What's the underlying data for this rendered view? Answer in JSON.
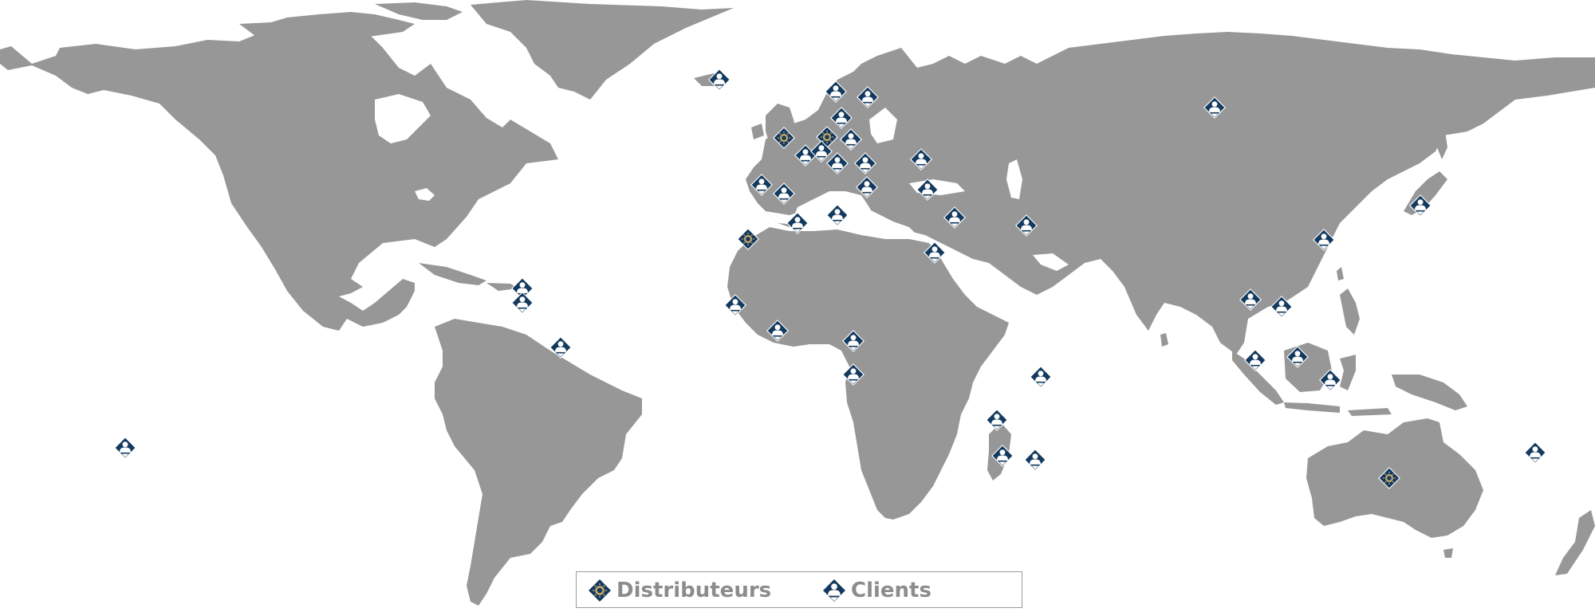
{
  "map": {
    "title": "",
    "colors": {
      "land": "#979797",
      "marker_fill": "#12395e",
      "distributor_accent": "#c0a46c",
      "legend_text": "#8c8c8c",
      "legend_border": "#9a9a9a"
    },
    "legend": {
      "items": [
        {
          "label": "Distributeurs",
          "icon": "distributor-marker-icon"
        },
        {
          "label": "Clients",
          "icon": "client-marker-icon"
        }
      ]
    },
    "markers": [
      {
        "type": "client",
        "region": "Greenland"
      },
      {
        "type": "client",
        "region": "Scandinavia"
      },
      {
        "type": "client",
        "region": "Scandinavia"
      },
      {
        "type": "distributor",
        "region": "United Kingdom"
      },
      {
        "type": "distributor",
        "region": "Western Europe"
      },
      {
        "type": "client",
        "region": "Europe"
      },
      {
        "type": "client",
        "region": "Europe"
      },
      {
        "type": "client",
        "region": "Europe"
      },
      {
        "type": "client",
        "region": "Europe"
      },
      {
        "type": "client",
        "region": "Europe"
      },
      {
        "type": "client",
        "region": "Europe"
      },
      {
        "type": "client",
        "region": "Eastern Europe"
      },
      {
        "type": "client",
        "region": "Iberia"
      },
      {
        "type": "client",
        "region": "Iberia"
      },
      {
        "type": "client",
        "region": "Balkans"
      },
      {
        "type": "client",
        "region": "Turkey"
      },
      {
        "type": "client",
        "region": "North Africa"
      },
      {
        "type": "client",
        "region": "North Africa"
      },
      {
        "type": "distributor",
        "region": "Morocco"
      },
      {
        "type": "client",
        "region": "Middle East"
      },
      {
        "type": "client",
        "region": "Gulf"
      },
      {
        "type": "client",
        "region": "Egypt"
      },
      {
        "type": "client",
        "region": "Russia"
      },
      {
        "type": "client",
        "region": "West Africa"
      },
      {
        "type": "client",
        "region": "West Africa"
      },
      {
        "type": "client",
        "region": "Central Africa"
      },
      {
        "type": "client",
        "region": "Central Africa"
      },
      {
        "type": "client",
        "region": "Indian Ocean"
      },
      {
        "type": "client",
        "region": "Madagascar"
      },
      {
        "type": "client",
        "region": "Madagascar"
      },
      {
        "type": "client",
        "region": "Mauritius"
      },
      {
        "type": "client",
        "region": "Caribbean"
      },
      {
        "type": "client",
        "region": "Caribbean"
      },
      {
        "type": "client",
        "region": "Guiana"
      },
      {
        "type": "client",
        "region": "Pacific"
      },
      {
        "type": "client",
        "region": "China"
      },
      {
        "type": "client",
        "region": "Japan"
      },
      {
        "type": "client",
        "region": "Southeast Asia"
      },
      {
        "type": "client",
        "region": "Southeast Asia"
      },
      {
        "type": "client",
        "region": "Southeast Asia"
      },
      {
        "type": "client",
        "region": "Borneo"
      },
      {
        "type": "client",
        "region": "Indonesia"
      },
      {
        "type": "distributor",
        "region": "Australia"
      },
      {
        "type": "client",
        "region": "New Caledonia"
      }
    ]
  }
}
